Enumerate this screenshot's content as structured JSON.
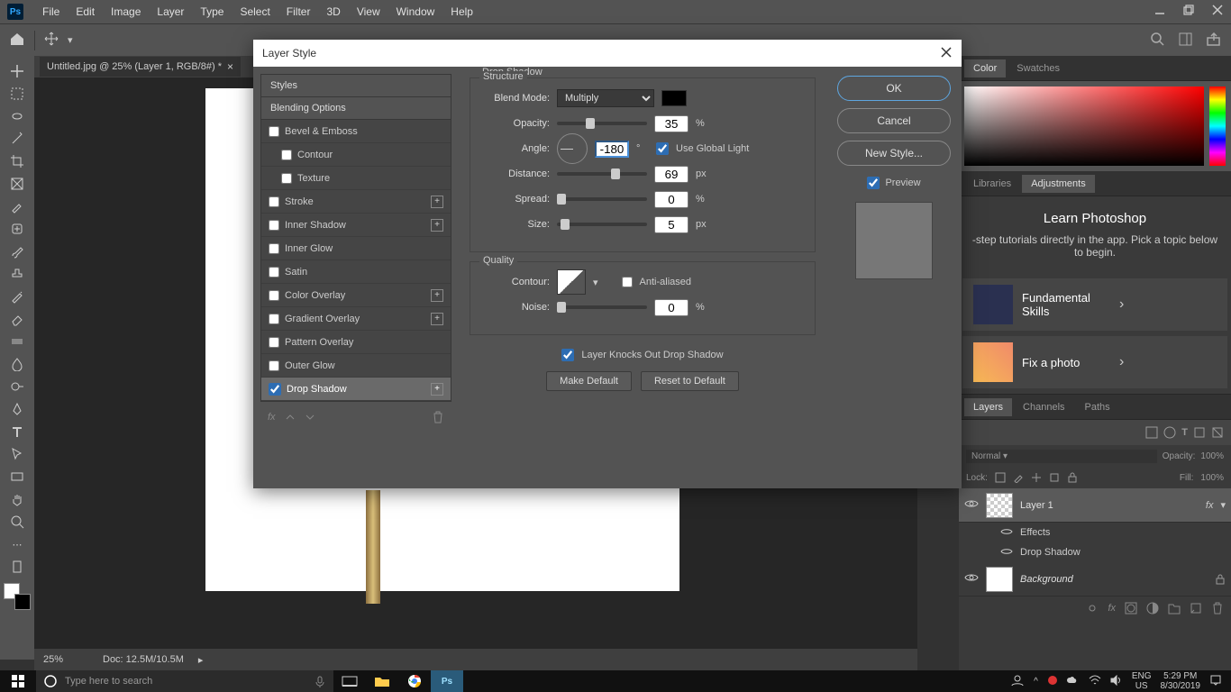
{
  "menu": {
    "items": [
      "File",
      "Edit",
      "Image",
      "Layer",
      "Type",
      "Select",
      "Filter",
      "3D",
      "View",
      "Window",
      "Help"
    ],
    "ps": "Ps"
  },
  "doc": {
    "tab": "Untitled.jpg @ 25% (Layer 1, RGB/8#) *"
  },
  "status": {
    "zoom": "25%",
    "docsize": "Doc: 12.5M/10.5M"
  },
  "dialog": {
    "title": "Layer Style",
    "sections": {
      "styles": "Styles",
      "blend": "Blending Options"
    },
    "items": [
      "Bevel & Emboss",
      "Contour",
      "Texture",
      "Stroke",
      "Inner Shadow",
      "Inner Glow",
      "Satin",
      "Color Overlay",
      "Gradient Overlay",
      "Pattern Overlay",
      "Outer Glow",
      "Drop Shadow"
    ],
    "group": "Drop Shadow",
    "structure": "Structure",
    "quality": "Quality",
    "labels": {
      "blend": "Blend Mode:",
      "opacity": "Opacity:",
      "angle": "Angle:",
      "globallight": "Use Global Light",
      "distance": "Distance:",
      "spread": "Spread:",
      "size": "Size:",
      "contour": "Contour:",
      "antialias": "Anti-aliased",
      "noise": "Noise:",
      "knockout": "Layer Knocks Out Drop Shadow",
      "makedefault": "Make Default",
      "resetdefault": "Reset to Default"
    },
    "vals": {
      "blendmode": "Multiply",
      "opacity": "35",
      "angle": "-180",
      "distance": "69",
      "spread": "0",
      "size": "5",
      "noise": "0"
    },
    "units": {
      "pct": "%",
      "deg": "°",
      "px": "px"
    },
    "buttons": {
      "ok": "OK",
      "cancel": "Cancel",
      "newstyle": "New Style...",
      "preview": "Preview"
    }
  },
  "rpanel": {
    "colorTabs": [
      "Color",
      "Swatches"
    ],
    "learnTabs": [
      "Libraries",
      "Adjustments"
    ],
    "learn": {
      "title": "Learn Photoshop",
      "sub": "-step tutorials directly in the app. Pick a topic below to begin.",
      "i1": "Fundamental Skills",
      "i2": "Fix a photo"
    },
    "layerTabs": [
      "Layers",
      "Channels",
      "Paths"
    ],
    "opacity": "Opacity:",
    "opval": "100%",
    "fill": "Fill:",
    "fillval": "100%",
    "lock": "Lock:",
    "l1": "Layer 1",
    "effects": "Effects",
    "ds": "Drop Shadow",
    "bg": "Background",
    "fx": "fx"
  },
  "taskbar": {
    "search": "Type here to search",
    "lang": "ENG",
    "region": "US",
    "time": "5:29 PM",
    "date": "8/30/2019"
  }
}
